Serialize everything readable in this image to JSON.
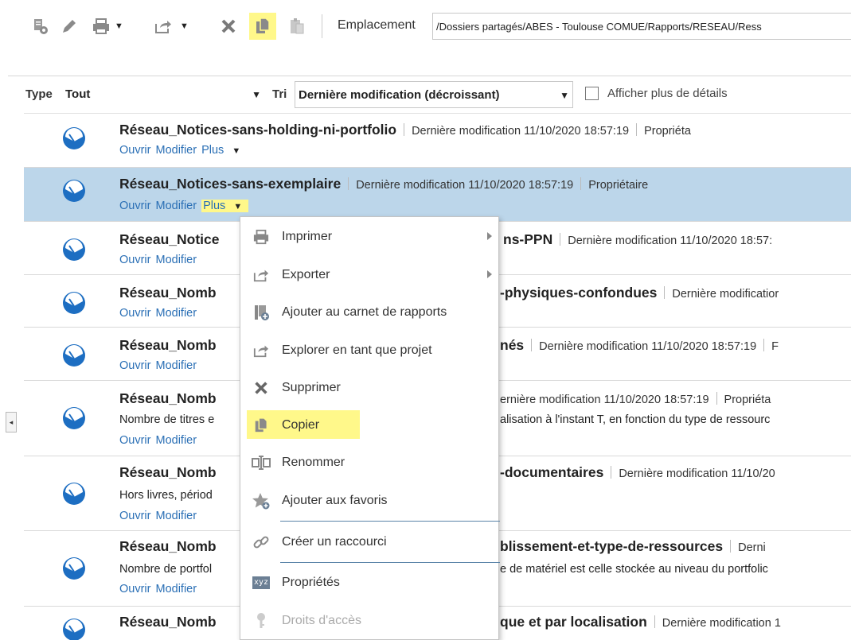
{
  "toolbar": {
    "location_label": "Emplacement",
    "location_value": "/Dossiers partagés/ABES - Toulouse COMUE/Rapports/RESEAU/Ress",
    "icons": [
      "properties-icon",
      "edit-icon",
      "print-icon",
      "export-icon",
      "delete-icon",
      "copy-icon",
      "paste-icon"
    ],
    "highlight_color": "#fff88a"
  },
  "filters": {
    "type_label": "Type",
    "type_value": "Tout",
    "sort_label": "Tri",
    "sort_value": "Dernière modification (décroissant)",
    "details_label": "Afficher plus de détails"
  },
  "rows": [
    {
      "title": "Réseau_Notices-sans-holding-ni-portfolio",
      "meta": "Dernière modification 11/10/2020 18:57:19",
      "owner": "Propriéta",
      "desc": "",
      "actions": {
        "open": "Ouvrir",
        "edit": "Modifier",
        "more": "Plus"
      }
    },
    {
      "title": "Réseau_Notices-sans-exemplaire",
      "meta": "Dernière modification 11/10/2020 18:57:19",
      "owner": "Propriétaire",
      "desc": "",
      "actions": {
        "open": "Ouvrir",
        "edit": "Modifier",
        "more": "Plus"
      }
    },
    {
      "title": "Réseau_Notice",
      "title_tail": "ns-PPN",
      "meta": "Dernière modification 11/10/2020 18:57:",
      "desc": "",
      "actions": {
        "open": "Ouvrir",
        "edit": "Modifier"
      }
    },
    {
      "title": "Réseau_Nomb",
      "title_tail": "-physiques-confondues",
      "meta": "Dernière modificatior",
      "desc": "",
      "actions": {
        "open": "Ouvrir",
        "edit": "Modifier"
      }
    },
    {
      "title": "Réseau_Nomb",
      "title_tail": "nés",
      "meta": "Dernière modification 11/10/2020 18:57:19",
      "owner": "F",
      "desc": "",
      "actions": {
        "open": "Ouvrir",
        "edit": "Modifier"
      }
    },
    {
      "title": "Réseau_Nomb",
      "title_tail": "",
      "meta": "ernière modification 11/10/2020 18:57:19",
      "owner": "Propriéta",
      "desc": "Nombre de titres e",
      "desc_tail": "alisation à l'instant T, en fonction du type de ressourc",
      "actions": {
        "open": "Ouvrir",
        "edit": "Modifier"
      }
    },
    {
      "title": "Réseau_Nomb",
      "title_tail": "-documentaires",
      "meta": "Dernière modification 11/10/20",
      "desc": "Hors livres, périod",
      "actions": {
        "open": "Ouvrir",
        "edit": "Modifier"
      }
    },
    {
      "title": "Réseau_Nomb",
      "title_tail": "blissement-et-type-de-ressources",
      "meta": "Derni",
      "desc": "Nombre de portfol",
      "desc_tail": "e de matériel est celle stockée au niveau du portfolic",
      "actions": {
        "open": "Ouvrir",
        "edit": "Modifier"
      }
    },
    {
      "title": "Réseau_Nomb",
      "title_tail": "que et par localisation",
      "meta": "Dernière modification 1",
      "desc": "",
      "actions": {
        "open": "Ouvrir",
        "edit": "Modifier"
      }
    }
  ],
  "menu": {
    "items": [
      {
        "label": "Imprimer",
        "icon": "print-icon",
        "submenu": true
      },
      {
        "label": "Exporter",
        "icon": "export-icon",
        "submenu": true
      },
      {
        "label": "Ajouter au carnet de rapports",
        "icon": "briefing-book-icon"
      },
      {
        "label": "Explorer en tant que projet",
        "icon": "explore-icon"
      },
      {
        "label": "Supprimer",
        "icon": "delete-icon"
      },
      {
        "label": "Copier",
        "icon": "copy-icon",
        "highlighted": true
      },
      {
        "label": "Renommer",
        "icon": "rename-icon"
      },
      {
        "label": "Ajouter aux favoris",
        "icon": "favorite-icon"
      },
      {
        "label": "Créer un raccourci",
        "icon": "shortcut-icon"
      },
      {
        "label": "Propriétés",
        "icon": "properties-icon"
      },
      {
        "label": "Droits d'accès",
        "icon": "permissions-icon",
        "disabled": true
      }
    ]
  },
  "colors": {
    "selected_row": "#bcd6ea",
    "link": "#2a6fb5",
    "report_icon": "#1d6ec2"
  }
}
